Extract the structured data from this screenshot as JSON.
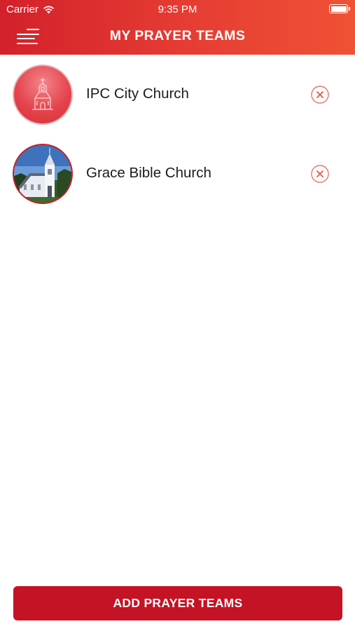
{
  "status_bar": {
    "carrier": "Carrier",
    "time": "9:35 PM"
  },
  "header": {
    "title": "MY PRAYER TEAMS",
    "background_start": "#d3212b",
    "background_end": "#ef5234"
  },
  "teams": [
    {
      "name": "IPC City Church",
      "avatar": "church-outline-icon"
    },
    {
      "name": "Grace Bible Church",
      "avatar": "church-photo"
    }
  ],
  "footer": {
    "add_label": "ADD PRAYER TEAMS",
    "button_color": "#c41324"
  },
  "icons": {
    "menu": "menu-icon",
    "remove": "remove-circle-x-icon",
    "wifi": "wifi-icon",
    "battery": "battery-icon"
  }
}
